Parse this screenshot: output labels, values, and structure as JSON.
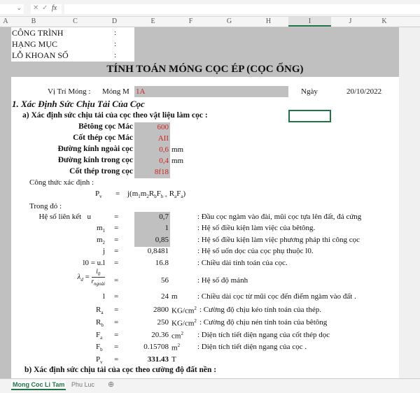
{
  "formula_bar": {
    "fx_label": "fx",
    "cancel": "✕",
    "confirm": "✓",
    "name_box": "⌄"
  },
  "columns": [
    "A",
    "B",
    "C",
    "D",
    "E",
    "F",
    "G",
    "H",
    "I",
    "J",
    "K"
  ],
  "header": {
    "cong_trinh": "CÔNG TRÌNH",
    "hang_muc": "HẠNG MỤC",
    "lo_khoan": "LỖ KHOAN SỐ",
    "colon": ":"
  },
  "title": "TÍNH TOÁN MÓNG CỌC ÉP (CỌC ỐNG)",
  "vi_tri": {
    "label": "Vị Trí Móng :",
    "prefix": "Móng  M",
    "value": "1A",
    "date_label": "Ngày",
    "date": "20/10/2022"
  },
  "section1": "1. Xác Định Sức Chịu Tải Của Cọc",
  "section_a": "a) Xác định sức chịu tải của cọc theo vật liệu làm cọc :",
  "inputs": [
    {
      "label": "Bêtông cọc Mác",
      "value": "600",
      "unit": ""
    },
    {
      "label": "Cốt thép cọc Mác",
      "value": "AII",
      "unit": ""
    },
    {
      "label": "Đường kính ngoài cọc",
      "value": "0,6",
      "unit": "mm"
    },
    {
      "label": "Đường kính trong cọc",
      "value": "0,4",
      "unit": "mm"
    },
    {
      "label": "Cốt thép trong cọc",
      "value": "8f18",
      "unit": ""
    }
  ],
  "cong_thuc_label": "Công thức xác định :",
  "formula": {
    "lhs": "Pv",
    "eq": "=",
    "rhs": "j(m1m2RbFb + RaFa)"
  },
  "trong_do": "Trong đó :",
  "params": [
    {
      "sym": "Hệ số liên kết   u",
      "value": "0,7",
      "unit": "",
      "desc": ": Đầu cọc ngàm vào đài, mũi cọc tựa lên đất, đá cứng",
      "shaded": true
    },
    {
      "sym": "m1",
      "value": "1",
      "unit": "",
      "desc": ": Hệ số điều kiện làm việc của bêtông.",
      "shaded": true
    },
    {
      "sym": "m2",
      "value": "0,85",
      "unit": "",
      "desc": ": Hệ số điều kiện làm việc phương pháp thi công cọc",
      "shaded": true
    },
    {
      "sym": "j",
      "value": "0,8481",
      "unit": "",
      "desc": ": Hệ số uốn dọc của cọc phụ thuộc l0.",
      "shaded": false
    },
    {
      "sym": "l0 = u.l",
      "value": "16.8",
      "unit": "",
      "desc": ": Chiều dài tính toán của cọc.",
      "shaded": false
    },
    {
      "sym": "λd = l0 / rngoài",
      "value": "56",
      "unit": "",
      "desc": ": Hệ số độ mảnh",
      "shaded": false
    },
    {
      "sym": "l",
      "value": "24",
      "unit": "m",
      "desc": ": Chiều dài cọc từ mũi cọc đến điểm ngàm vào đất .",
      "shaded": false
    },
    {
      "sym": "Ra",
      "value": "2800",
      "unit": "KG/cm²",
      "desc": ": Cường độ chịu kéo tính toán của thép.",
      "shaded": false
    },
    {
      "sym": "Rb",
      "value": "250",
      "unit": "KG/cm²",
      "desc": ": Cường độ chịu nén tính toán của bêtông",
      "shaded": false
    },
    {
      "sym": "Fa",
      "value": "20.36",
      "unit": "cm²",
      "desc": ": Diện tích tiết diện ngang của cốt thép dọc",
      "shaded": false
    },
    {
      "sym": "Fb",
      "value": "0.15708",
      "unit": "m²",
      "desc": ": Diện tích tiết diện ngang của cọc .",
      "shaded": false
    },
    {
      "sym": "Pv",
      "value": "331.43",
      "unit": "T",
      "desc": "",
      "shaded": false
    }
  ],
  "section_b": "b) Xác định sức chịu tải của cọc theo cường độ đất nền :",
  "tabs": {
    "active": "Mong Coc Li Tam",
    "other": "Phu Luc",
    "add": "⊕"
  },
  "colors": {
    "input_red": "#d21e1e",
    "shade": "#c0c0c0",
    "active_tab": "#217346"
  }
}
